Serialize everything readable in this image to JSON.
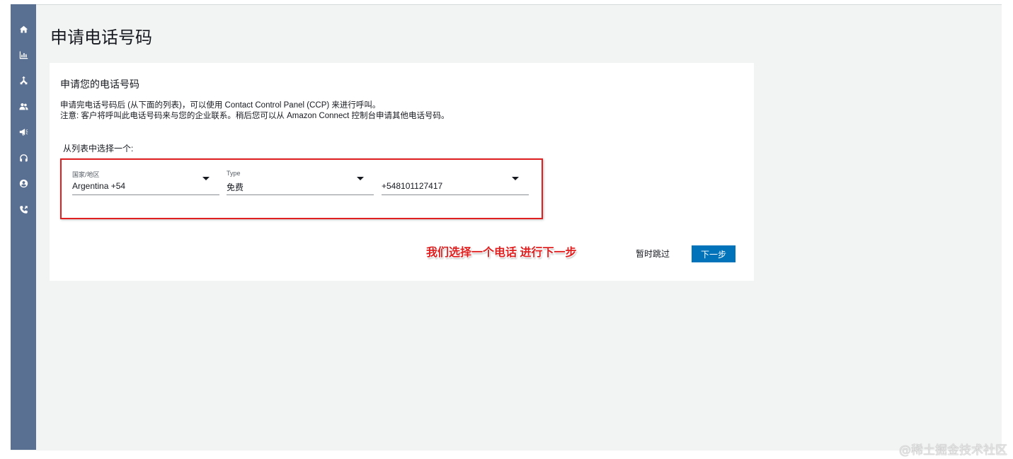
{
  "page": {
    "title": "申请电话号码"
  },
  "sidebar": {
    "items": [
      {
        "icon": "home-icon"
      },
      {
        "icon": "bar-chart-icon"
      },
      {
        "icon": "routing-icon"
      },
      {
        "icon": "users-icon"
      },
      {
        "icon": "megaphone-icon"
      },
      {
        "icon": "headset-icon"
      },
      {
        "icon": "user-circle-icon"
      },
      {
        "icon": "phone-icon"
      }
    ]
  },
  "card": {
    "title": "申请您的电话号码",
    "description_line1": "申请完电话号码后 (从下面的列表)，可以使用 Contact Control Panel (CCP) 来进行呼叫。",
    "description_line2": "注意: 客户将呼叫此电话号码来与您的企业联系。稍后您可以从 Amazon Connect 控制台申请其他电话号码。",
    "select_prompt": "从列表中选择一个:",
    "fields": {
      "country": {
        "label": "国家/地区",
        "value": "Argentina +54"
      },
      "type": {
        "label": "Type",
        "value": "免费"
      },
      "number": {
        "label": "",
        "value": "+548101127417"
      }
    },
    "annotation": "我们选择一个电话 进行下一步",
    "skip_label": "暂时跳过",
    "next_label": "下一步"
  },
  "watermark": "@稀土掘金技术社区",
  "colors": {
    "sidebar": "#5a7092",
    "primary_button": "#0073bb",
    "annotation": "#e02020",
    "background": "#f2f3f3"
  }
}
